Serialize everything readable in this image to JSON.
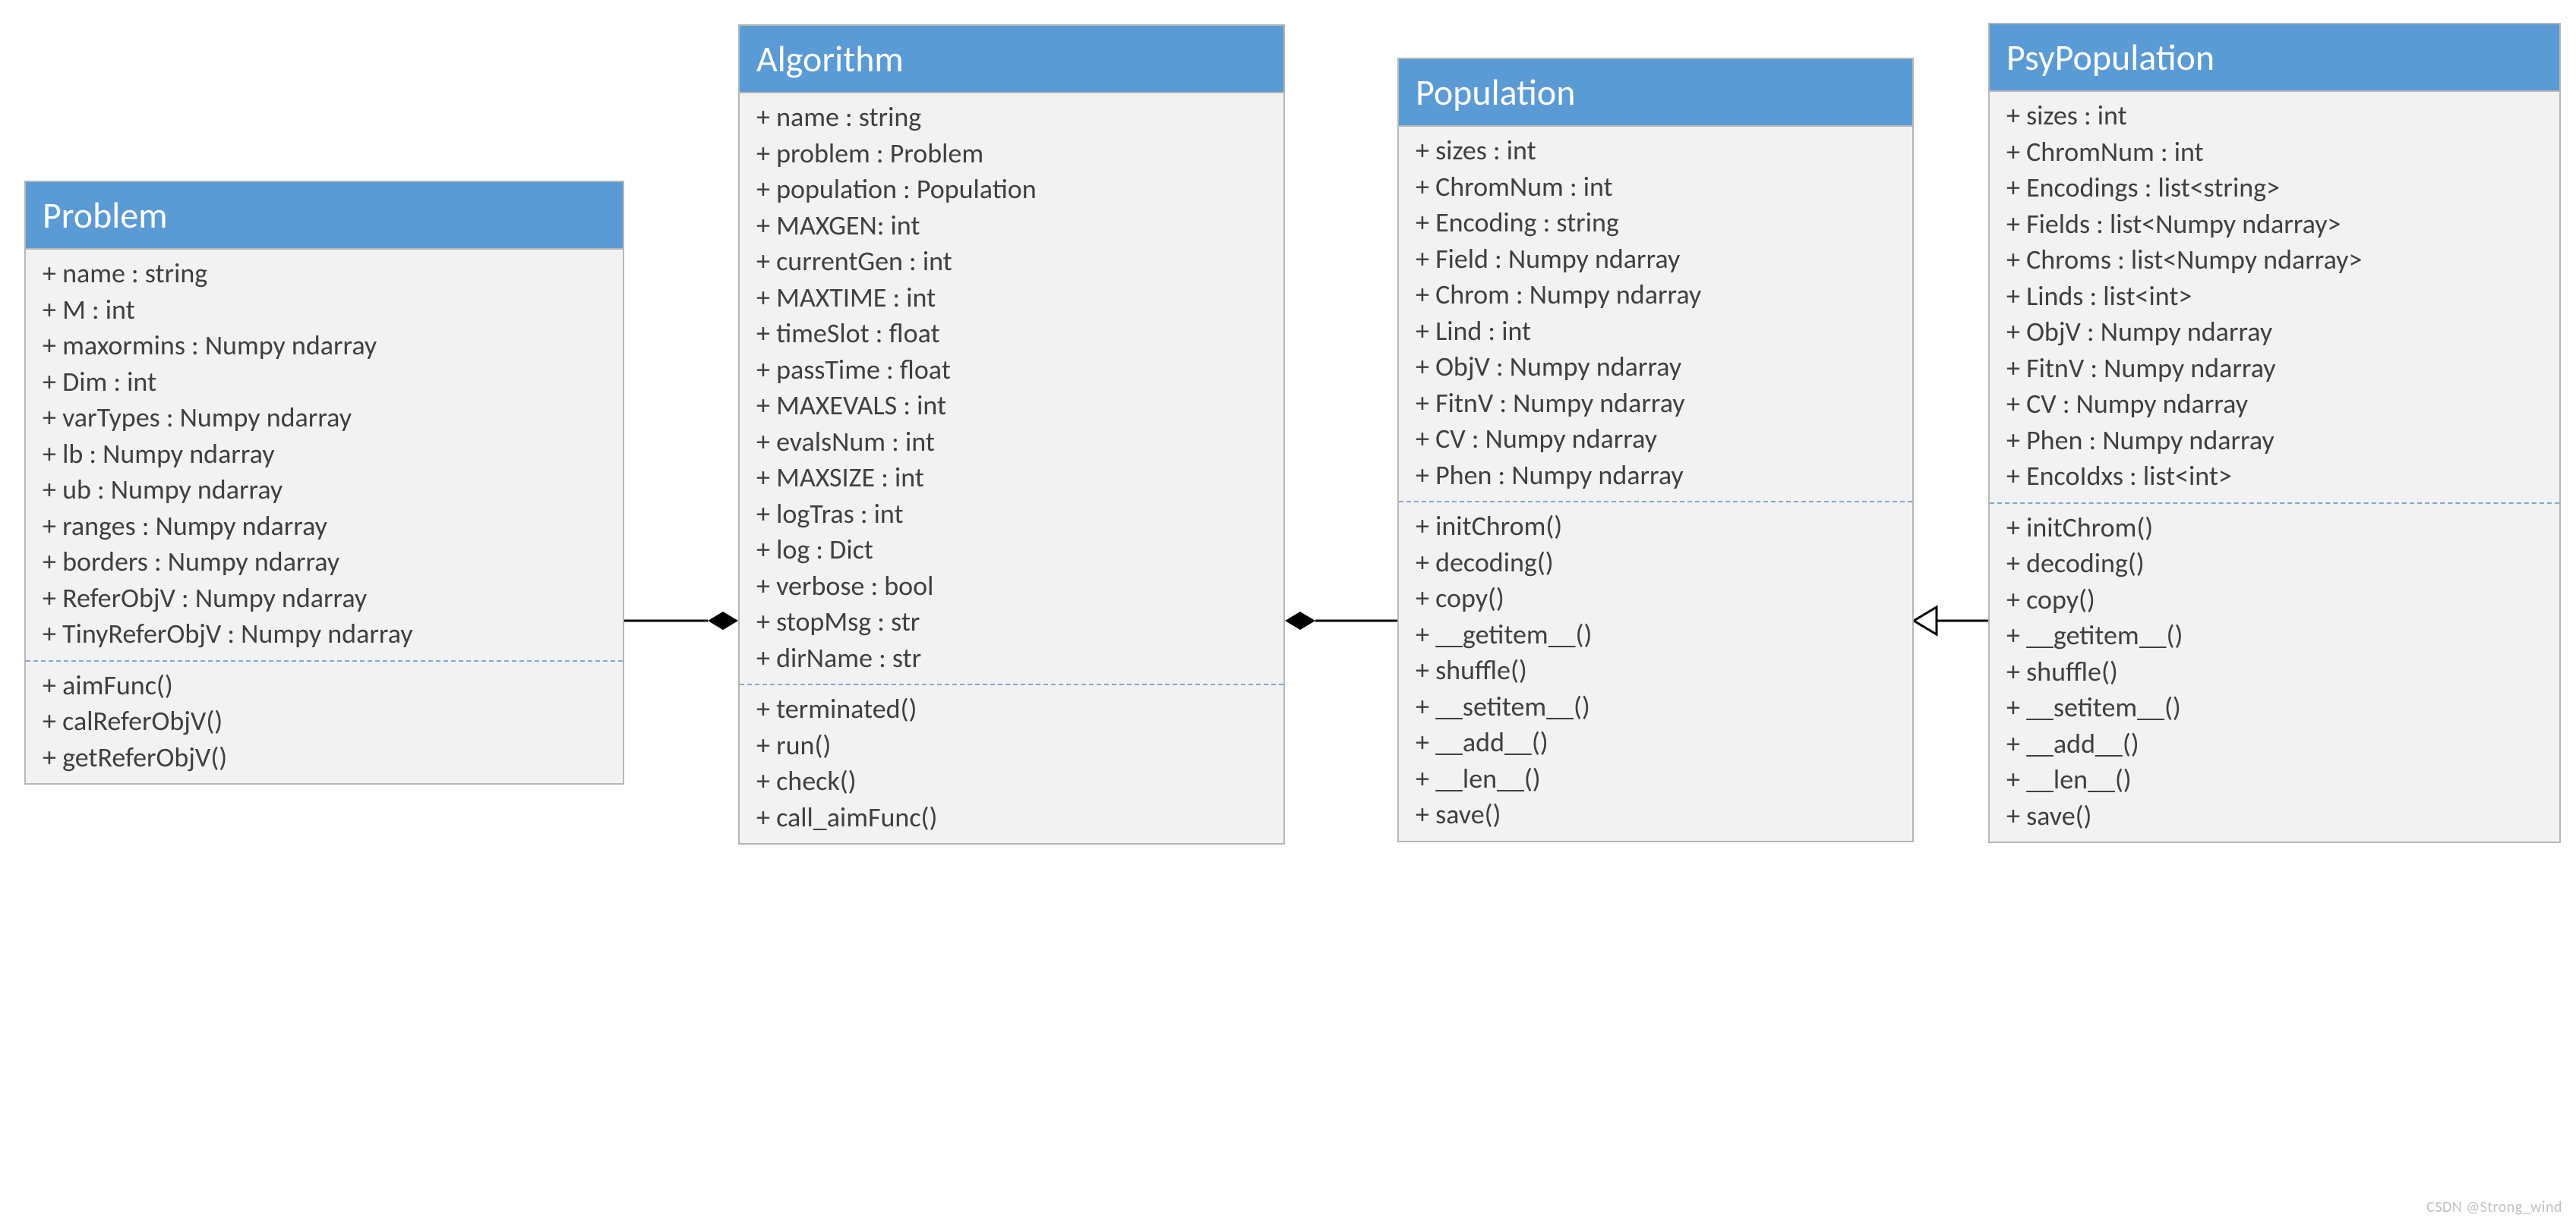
{
  "classes": {
    "problem": {
      "title": "Problem",
      "attrs": [
        "+ name : string",
        "+ M : int",
        "+ maxormins : Numpy ndarray",
        "+ Dim : int",
        "+ varTypes : Numpy ndarray",
        "+ lb : Numpy ndarray",
        "+ ub : Numpy ndarray",
        "+ ranges : Numpy ndarray",
        "+ borders : Numpy ndarray",
        "+ ReferObjV : Numpy ndarray",
        "+ TinyReferObjV : Numpy ndarray"
      ],
      "methods": [
        "+ aimFunc()",
        "+ calReferObjV()",
        "+ getReferObjV()"
      ]
    },
    "algorithm": {
      "title": "Algorithm",
      "attrs": [
        "+ name : string",
        "+ problem : Problem",
        "+ population : Population",
        "+ MAXGEN: int",
        "+ currentGen : int",
        "+ MAXTIME : int",
        "+ timeSlot : float",
        "+ passTime : float",
        "+ MAXEVALS : int",
        "+ evalsNum : int",
        "+ MAXSIZE : int",
        "+ logTras : int",
        "+ log : Dict",
        "+ verbose : bool",
        "+ stopMsg : str",
        "+ dirName : str"
      ],
      "methods": [
        "+ terminated()",
        "+ run()",
        "+ check()",
        "+ call_aimFunc()"
      ]
    },
    "population": {
      "title": "Population",
      "attrs": [
        "+ sizes : int",
        "+ ChromNum : int",
        "+ Encoding : string",
        "+ Field : Numpy ndarray",
        "+ Chrom : Numpy ndarray",
        "+ Lind : int",
        "+ ObjV : Numpy ndarray",
        "+ FitnV : Numpy ndarray",
        "+ CV : Numpy ndarray",
        "+ Phen : Numpy ndarray"
      ],
      "methods": [
        "+ initChrom()",
        "+ decoding()",
        "+ copy()",
        "+ __getitem__()",
        "+ shuffle()",
        "+ __setitem__()",
        "+ __add__()",
        "+ __len__()",
        "+ save()"
      ]
    },
    "psypopulation": {
      "title": "PsyPopulation",
      "attrs": [
        "+ sizes : int",
        "+ ChromNum : int",
        "+ Encodings : list<string>",
        "+ Fields : list<Numpy ndarray>",
        "+ Chroms : list<Numpy ndarray>",
        "+ Linds : list<int>",
        "+ ObjV : Numpy ndarray",
        "+ FitnV : Numpy ndarray",
        "+ CV : Numpy ndarray",
        "+ Phen : Numpy ndarray",
        "+ EncoIdxs : list<int>"
      ],
      "methods": [
        "+ initChrom()",
        "+ decoding()",
        "+ copy()",
        "+ __getitem__()",
        "+ shuffle()",
        "+ __setitem__()",
        "+ __add__()",
        "+ __len__()",
        "+ save()"
      ]
    }
  },
  "watermark": "CSDN @Strong_wind"
}
